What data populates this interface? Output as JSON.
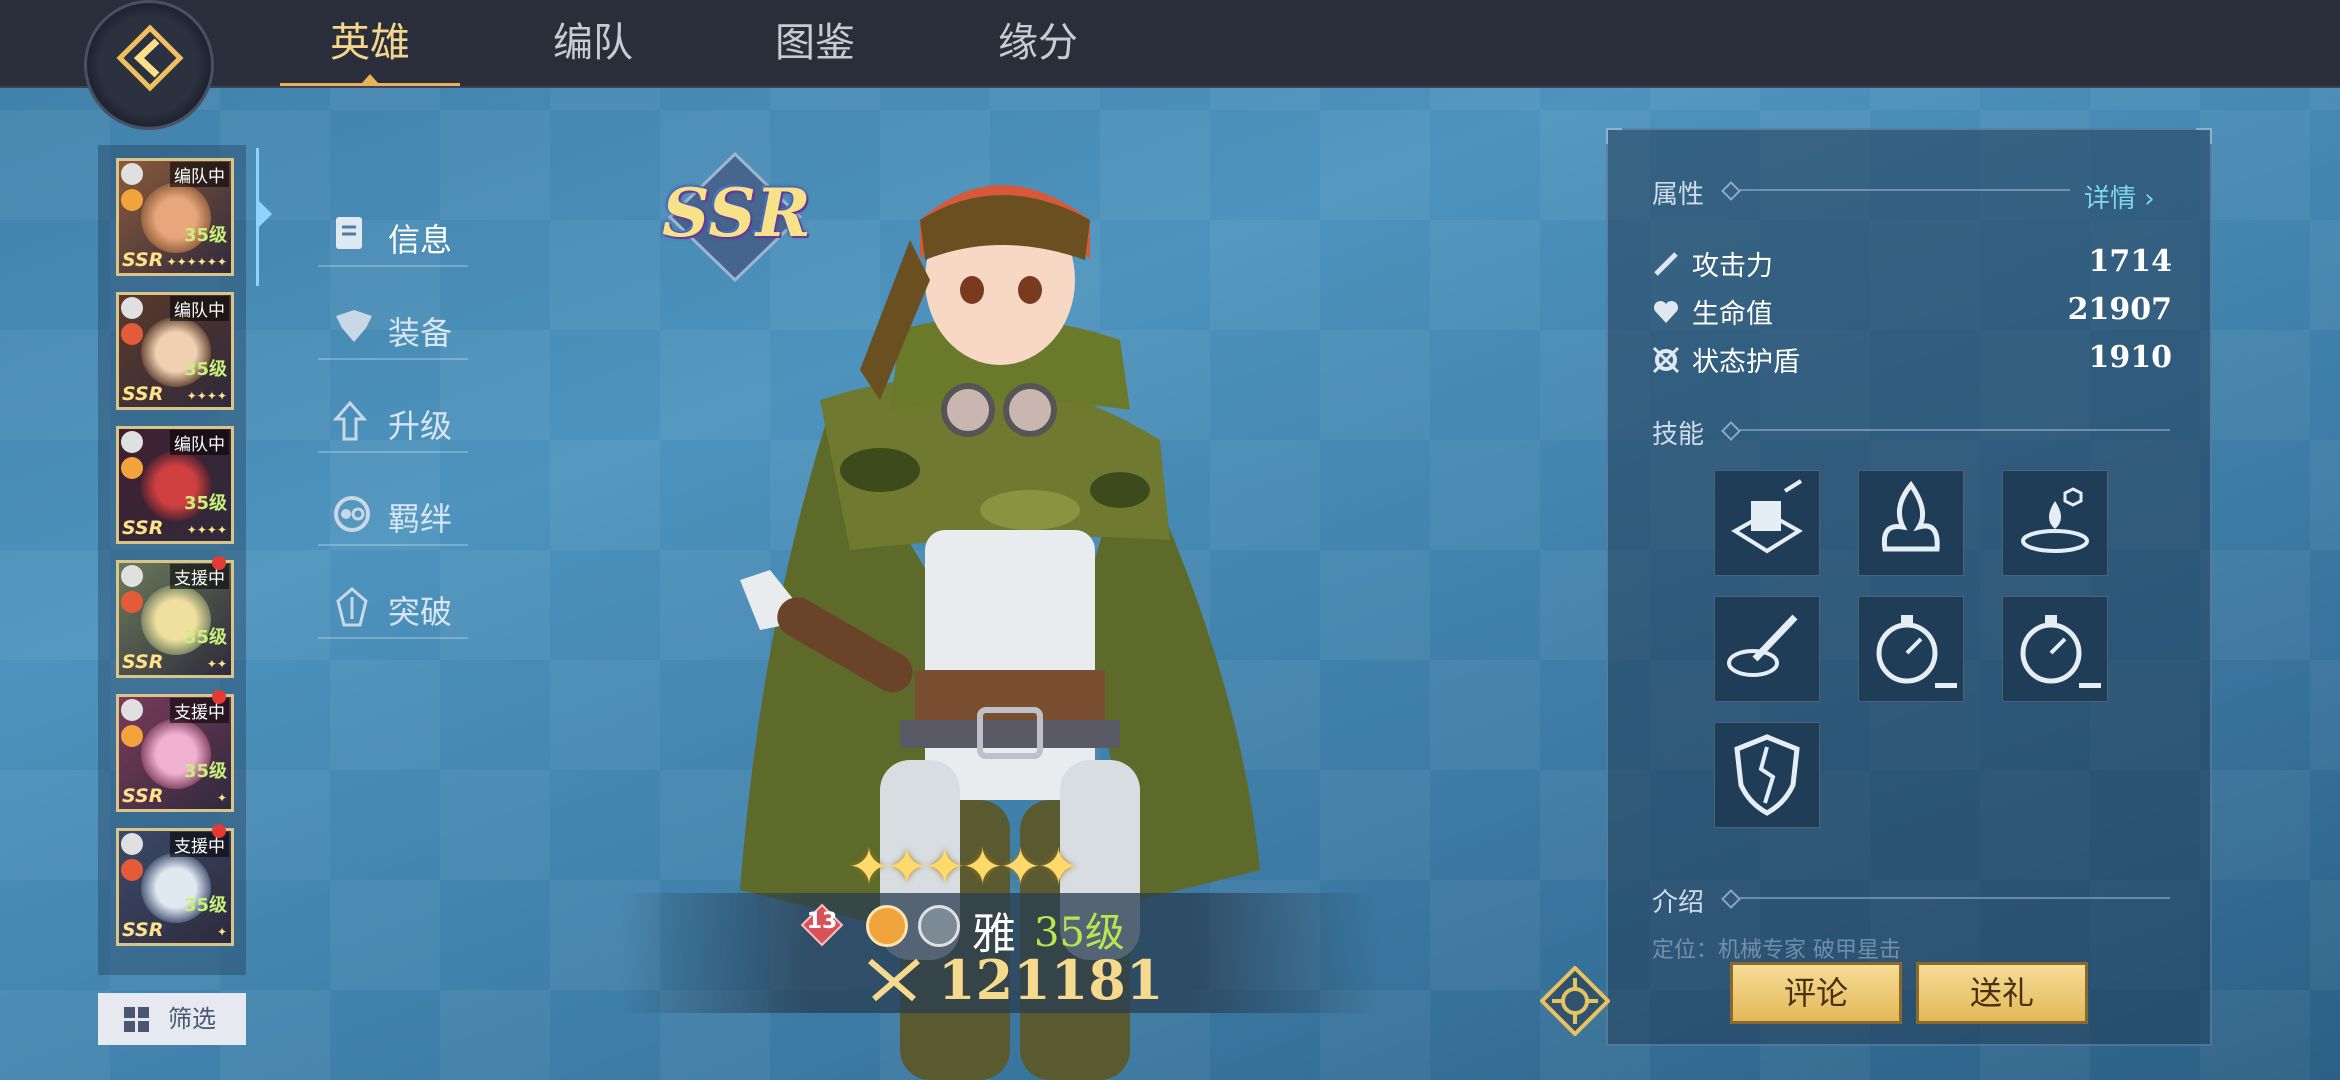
{
  "tabs": [
    "英雄",
    "编队",
    "图鉴",
    "缘分"
  ],
  "left_list": [
    {
      "badge": "编队中",
      "lvl": "35级",
      "rar": "SSR",
      "stars": "✦✦✦✦✦✦",
      "dot": false,
      "c1": "#8a5a3a",
      "c2": "#e8a77a"
    },
    {
      "badge": "编队中",
      "lvl": "35级",
      "rar": "SSR",
      "stars": "✦✦✦✦",
      "dot": false,
      "c1": "#5a3a2a",
      "c2": "#f0d0b0"
    },
    {
      "badge": "编队中",
      "lvl": "35级",
      "rar": "SSR",
      "stars": "✦✦✦✦",
      "dot": false,
      "c1": "#402030",
      "c2": "#d04040"
    },
    {
      "badge": "支援中",
      "lvl": "35级",
      "rar": "SSR",
      "stars": "✦✦",
      "dot": true,
      "c1": "#6a7a5a",
      "c2": "#f0e0a0"
    },
    {
      "badge": "支援中",
      "lvl": "35级",
      "rar": "SSR",
      "stars": "✦",
      "dot": true,
      "c1": "#7a3a5a",
      "c2": "#f0b0d0"
    },
    {
      "badge": "支援中",
      "lvl": "35级",
      "rar": "SSR",
      "stars": "✦",
      "dot": true,
      "c1": "#3a4a6a",
      "c2": "#e0e8f0"
    }
  ],
  "filter_label": "筛选",
  "submenu": [
    "信息",
    "装备",
    "升级",
    "羁绊",
    "突破"
  ],
  "rarity": "SSR",
  "hero": {
    "rank": "13",
    "name": "雅",
    "level": "35级",
    "power": "121181",
    "stars": "✦✦✦✦✦✦"
  },
  "attributes": {
    "title": "属性",
    "detail": "详情",
    "stats": [
      {
        "name": "攻击力",
        "value": "1714"
      },
      {
        "name": "生命值",
        "value": "21907"
      },
      {
        "name": "状态护盾",
        "value": "1910"
      }
    ]
  },
  "skills_title": "技能",
  "skills": [
    "breakout-skill-icon",
    "fire-burst-skill-icon",
    "water-drop-skill-icon",
    "sword-strike-skill-icon",
    "stopwatch-skill-icon",
    "stopwatch-skill-icon-2",
    "broken-shield-skill-icon"
  ],
  "intro_title": "介绍",
  "intro_text": "定位：机械专家 破甲星击",
  "buttons": {
    "review": "评论",
    "gift": "送礼"
  },
  "colors": {
    "accent": "#e8b25a",
    "topbar": "#2a2e3a",
    "level_green": "#b6e84d",
    "power_gold": "#f5d98c"
  }
}
